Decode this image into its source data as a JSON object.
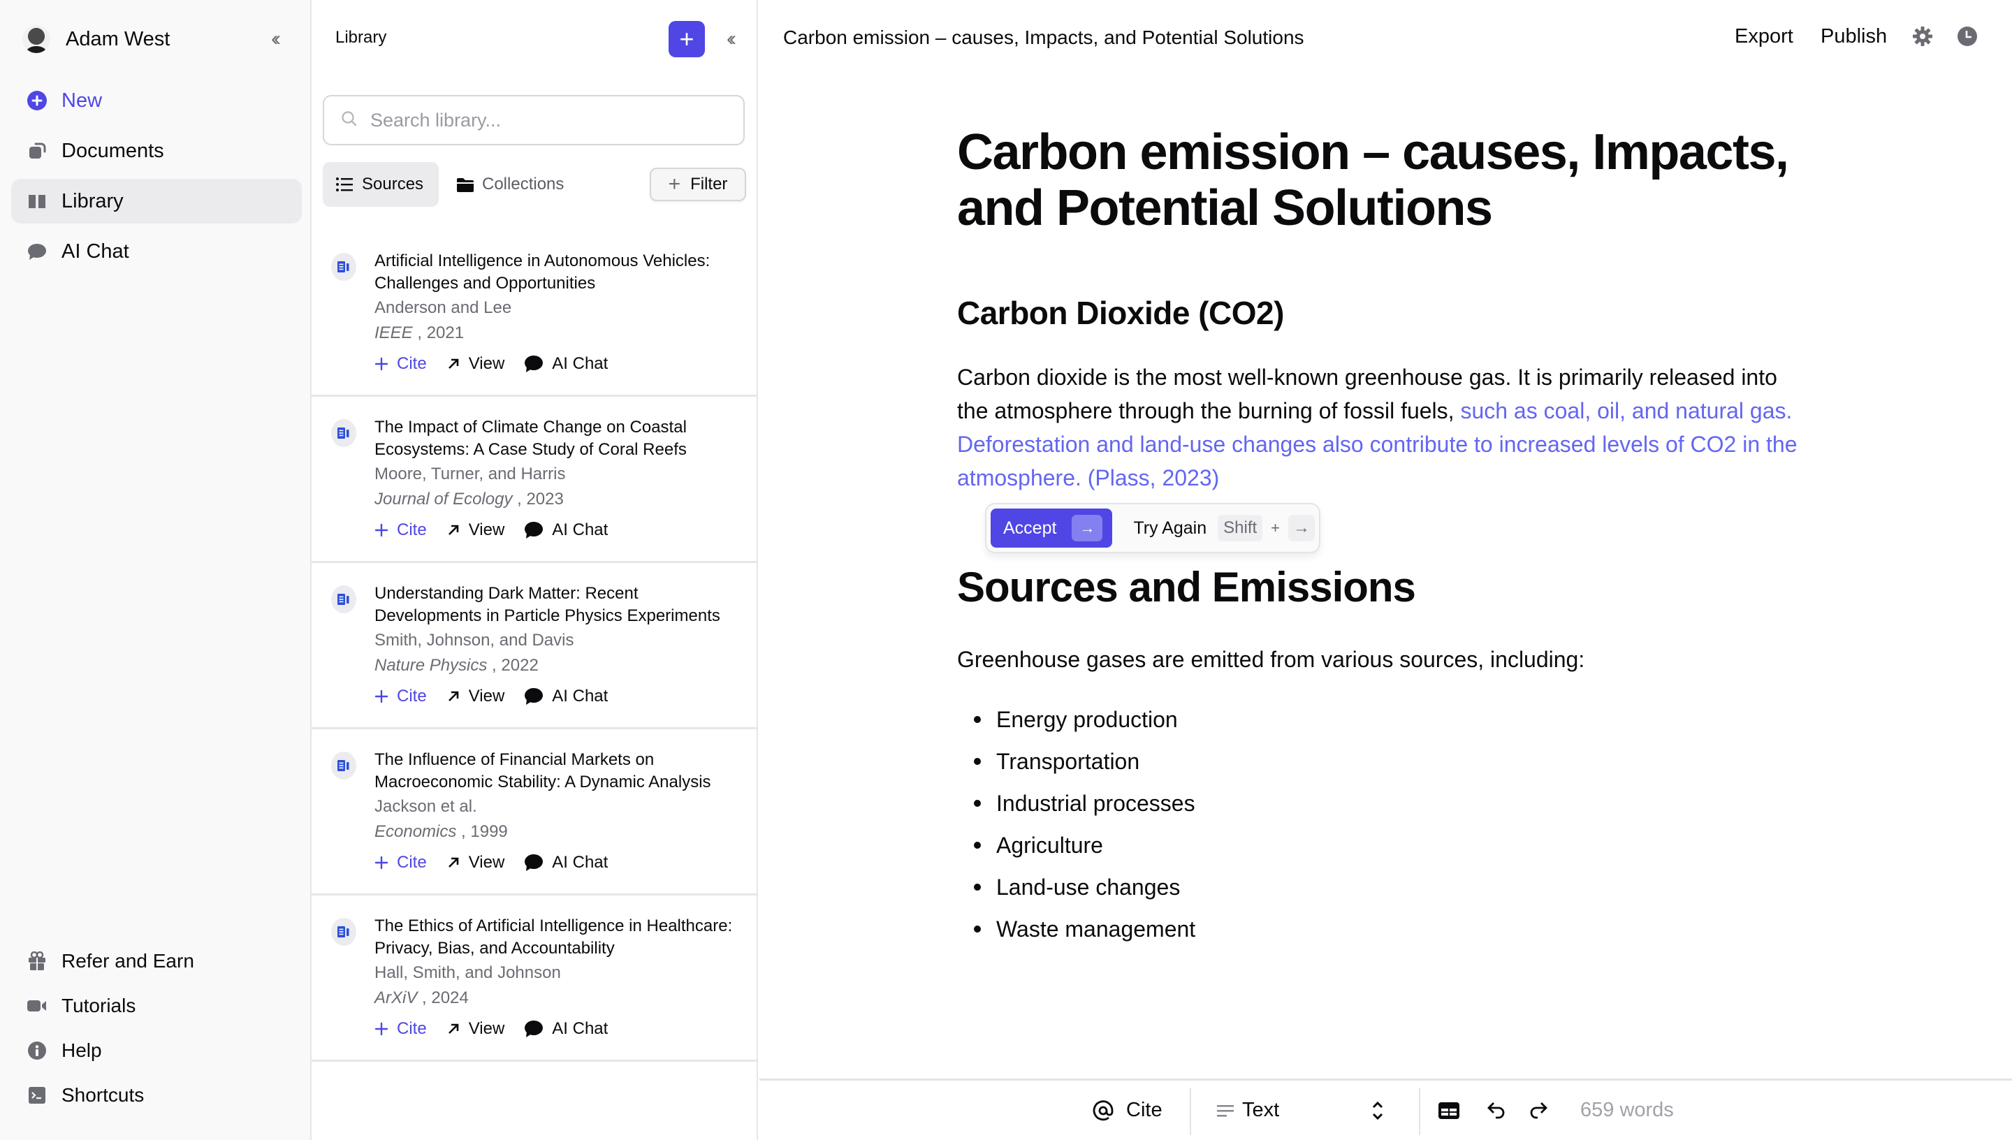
{
  "nav": {
    "user_name": "Adam West",
    "collapse_icon": "double-chevron-left-icon",
    "items": [
      {
        "label": "New",
        "icon": "plus-circle-icon"
      },
      {
        "label": "Documents",
        "icon": "documents-icon"
      },
      {
        "label": "Library",
        "icon": "book-open-icon",
        "active": true
      },
      {
        "label": "AI Chat",
        "icon": "chat-bubble-icon"
      }
    ],
    "bottom_items": [
      {
        "label": "Refer and Earn",
        "icon": "gift-icon"
      },
      {
        "label": "Tutorials",
        "icon": "video-camera-icon"
      },
      {
        "label": "Help",
        "icon": "info-circle-icon"
      },
      {
        "label": "Shortcuts",
        "icon": "terminal-icon"
      }
    ]
  },
  "library": {
    "title": "Library",
    "search_placeholder": "Search library...",
    "search_value": "",
    "tabs": [
      {
        "label": "Sources",
        "active": true
      },
      {
        "label": "Collections",
        "active": false
      }
    ],
    "filter_label": "Filter",
    "actions": {
      "cite": "Cite",
      "view": "View",
      "chat": "AI Chat"
    },
    "sources": [
      {
        "title": "Artificial Intelligence in Autonomous Vehicles: Challenges and Opportunities",
        "authors": "Anderson and Lee",
        "venue": "IEEE",
        "year": "2021"
      },
      {
        "title": "The Impact of Climate Change on Coastal Ecosystems: A Case Study of Coral Reefs",
        "authors": "Moore, Turner, and Harris",
        "venue": "Journal of Ecology",
        "year": "2023"
      },
      {
        "title": "Understanding Dark Matter: Recent Developments in Particle Physics Experiments",
        "authors": "Smith, Johnson, and Davis",
        "venue": "Nature Physics",
        "year": "2022"
      },
      {
        "title": "The Influence of Financial Markets on Macroeconomic Stability: A Dynamic Analysis",
        "authors": "Jackson et al.",
        "venue": "Economics",
        "year": "1999"
      },
      {
        "title": "The Ethics of Artificial Intelligence in Healthcare: Privacy, Bias, and Accountability",
        "authors": "Hall, Smith, and Johnson",
        "venue": "ArXiV",
        "year": "2024"
      }
    ]
  },
  "topbar": {
    "doc_title": "Carbon emission – causes, Impacts, and Potential Solutions",
    "export_label": "Export",
    "publish_label": "Publish",
    "settings_icon": "gear-icon",
    "history_icon": "clock-icon"
  },
  "document": {
    "title": "Carbon emission – causes, Impacts, and Potential Solutions",
    "section1_heading": "Carbon Dioxide (CO2)",
    "section1_text_plain": "Carbon dioxide is the most well-known greenhouse gas. It is primarily released into the atmosphere through the burning of fossil fuels, ",
    "section1_text_suggested": "such as coal, oil, and natural gas. Deforestation and land-use changes also contribute to increased levels of CO2 in the atmosphere. (Plass, 2023)",
    "section2_heading": "Sources and Emissions",
    "section2_intro": "Greenhouse gases are emitted from various sources, including:",
    "section2_list": [
      "Energy production",
      "Transportation",
      "Industrial processes",
      "Agriculture",
      "Land-use changes",
      "Waste management"
    ]
  },
  "suggestion_bar": {
    "accept_label": "Accept",
    "accept_key": "→",
    "try_again_label": "Try Again",
    "shortcut_modifier": "Shift",
    "shortcut_plus": "+",
    "shortcut_key": "→"
  },
  "bottombar": {
    "cite_label": "Cite",
    "text_style_label": "Text",
    "word_count": "659 words"
  },
  "colors": {
    "accent": "#4f46e5",
    "suggestion_text": "#6366f1",
    "sidebar_bg": "#f9f9fa"
  }
}
